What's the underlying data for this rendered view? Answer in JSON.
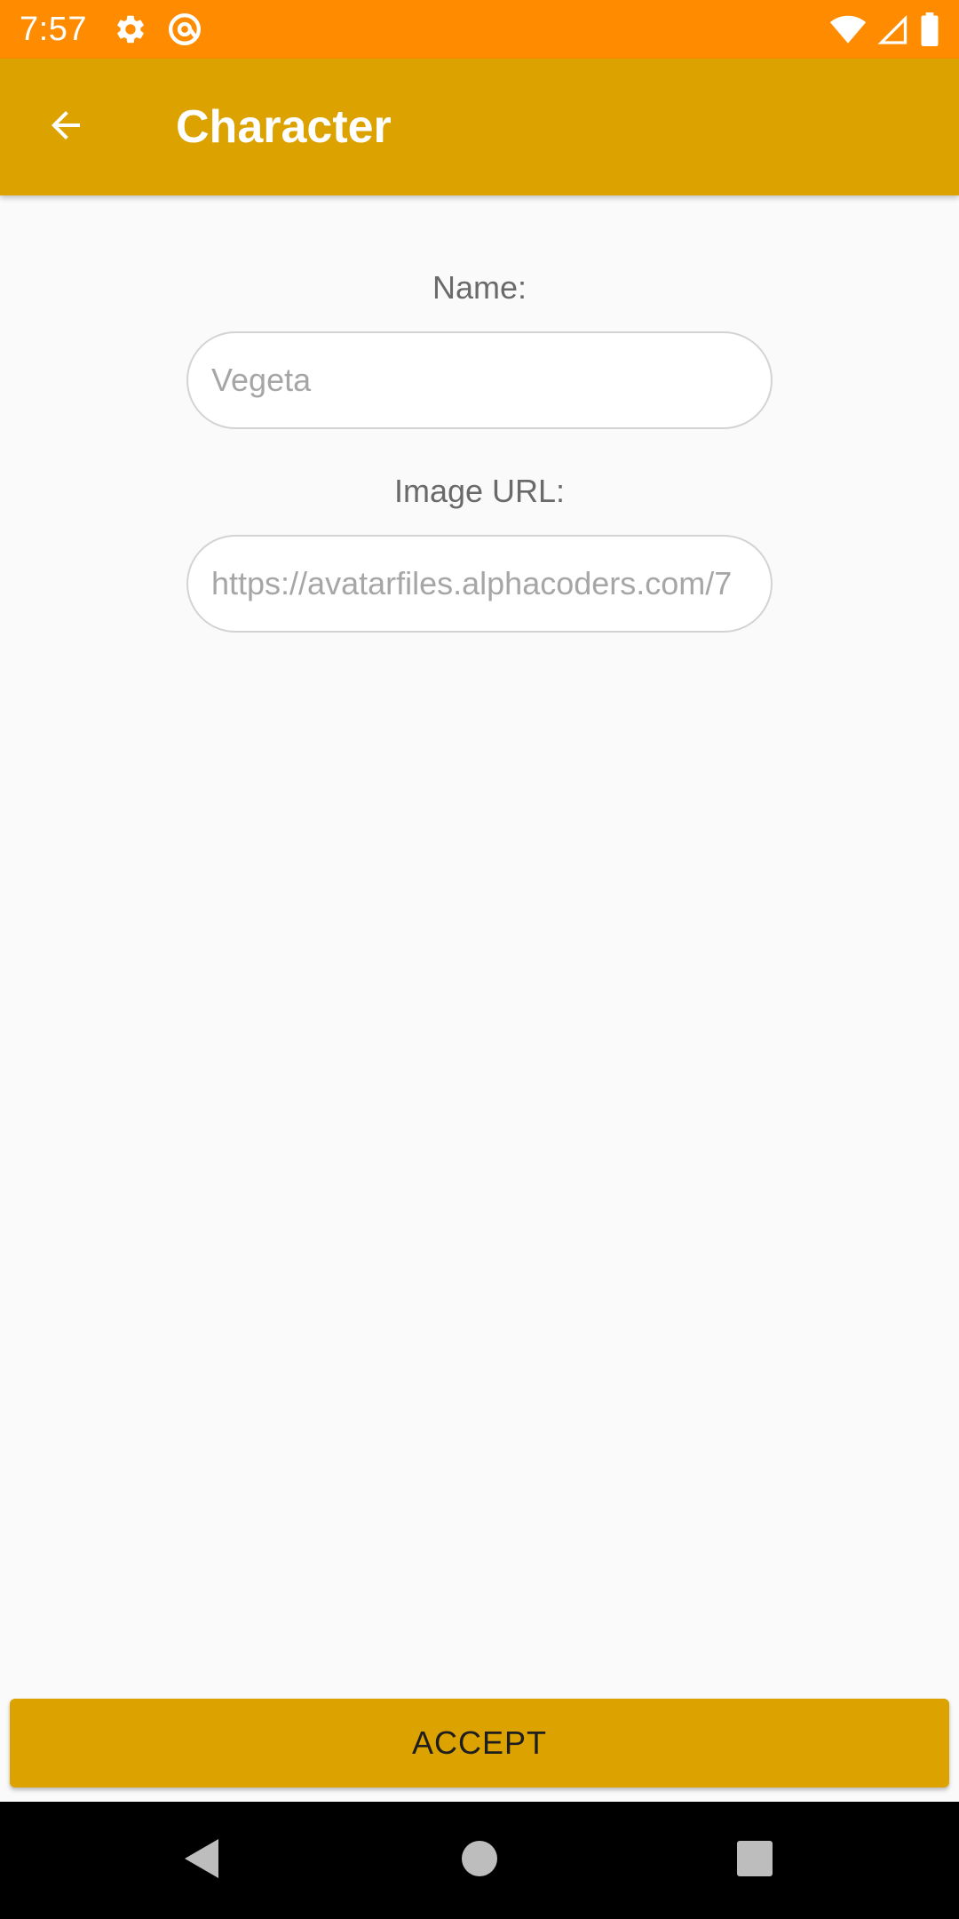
{
  "status_bar": {
    "time": "7:57",
    "icons": [
      "settings-gear-icon",
      "at-sign-icon",
      "wifi-icon",
      "cell-signal-icon",
      "battery-icon"
    ],
    "color": "#ff8c00"
  },
  "app_bar": {
    "title": "Character",
    "back_icon": "arrow-back-icon",
    "color": "#dba200"
  },
  "form": {
    "name": {
      "label": "Name:",
      "placeholder": "Vegeta"
    },
    "image_url": {
      "label": "Image URL:",
      "placeholder": "https://avatarfiles.alphacoders.com/7"
    }
  },
  "accept_button": {
    "label": "ACCEPT",
    "color": "#dba200"
  },
  "nav_bar": {
    "icons": [
      "back-triangle-icon",
      "home-circle-icon",
      "recents-square-icon"
    ]
  }
}
